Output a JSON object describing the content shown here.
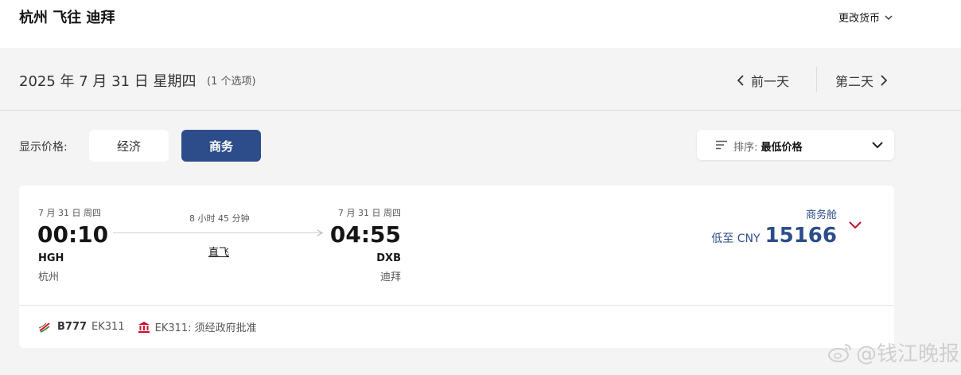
{
  "header": {
    "route_title": "杭州 飞往 迪拜",
    "currency_label": "更改货币"
  },
  "date_bar": {
    "date": "2025 年 7 月 31 日 星期四",
    "option_count": "(1 个选项)",
    "prev_label": "前一天",
    "next_label": "第二天"
  },
  "filters": {
    "price_label": "显示价格:",
    "economy_label": "经济",
    "business_label": "商务",
    "selected": "商务",
    "sort_label": "排序:",
    "sort_value": "最低价格"
  },
  "flight": {
    "departure": {
      "date": "7 月 31 日 周四",
      "time": "00:10",
      "code": "HGH",
      "city": "杭州"
    },
    "arrival": {
      "date": "7 月 31 日 周四",
      "time": "04:55",
      "code": "DXB",
      "city": "迪拜"
    },
    "duration": "8 小时 45 分钟",
    "stops": "直飞",
    "cabin": "商务舱",
    "price_prefix": "低至 CNY",
    "price": "15166",
    "aircraft": "B777",
    "flight_number": "EK311",
    "notice": "EK311: 须经政府批准"
  },
  "watermark": "@钱江晚报",
  "colors": {
    "brand_blue": "#2d4d8a",
    "accent_red": "#c8102e",
    "background": "#f4f4f4"
  },
  "icons": [
    "chevron-down-icon",
    "chevron-left-icon",
    "chevron-right-icon",
    "sort-icon",
    "arrow-right-icon",
    "emirates-logo-icon",
    "government-icon",
    "weibo-icon"
  ]
}
